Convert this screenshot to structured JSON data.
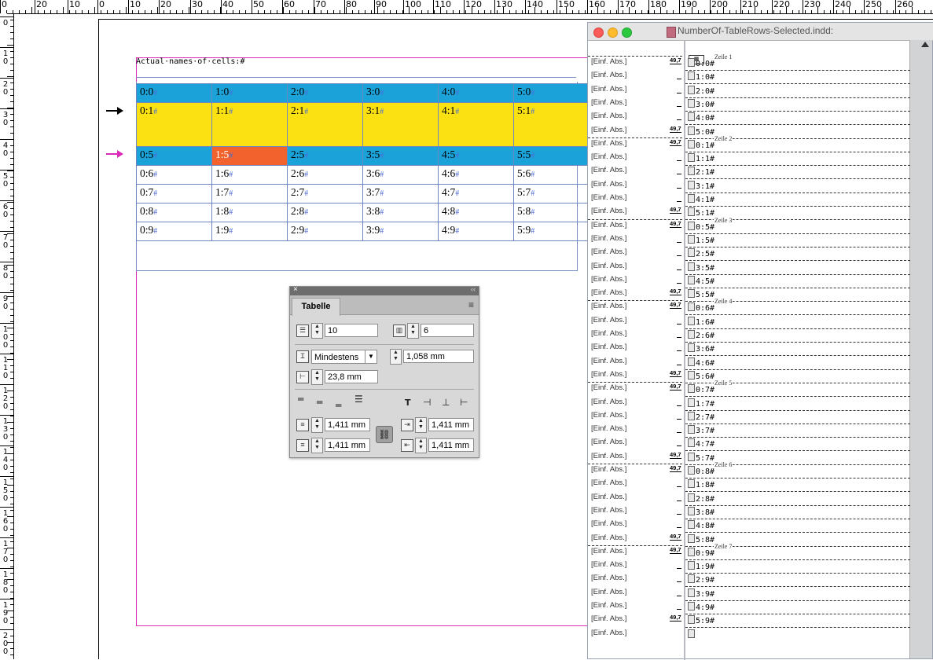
{
  "ruler": {
    "top_labels": [
      "0",
      "20",
      "10",
      "0",
      "10",
      "20",
      "30",
      "40",
      "50",
      "60",
      "70",
      "80",
      "90",
      "100",
      "110",
      "120",
      "130",
      "140",
      "150",
      "160",
      "170",
      "180",
      "190",
      "200",
      "210",
      "220",
      "230",
      "240",
      "250",
      "260"
    ],
    "left_labels": [
      "0",
      "10",
      "20",
      "30",
      "40",
      "50",
      "60",
      "70",
      "80",
      "90",
      "100",
      "110",
      "120",
      "130",
      "140",
      "150",
      "160",
      "170",
      "180",
      "190",
      "200"
    ]
  },
  "frame": {
    "header": "Actual·names·of·cells:#"
  },
  "table": {
    "rows": [
      [
        "0:0",
        "1:0",
        "2:0",
        "3:0",
        "4:0",
        "5:0"
      ],
      [
        "0:1",
        "1:1",
        "2:1",
        "3:1",
        "4:1",
        "5:1"
      ],
      [
        "0:5",
        "1:5",
        "2:5",
        "3:5",
        "4:5",
        "5:5"
      ],
      [
        "0:6",
        "1:6",
        "2:6",
        "3:6",
        "4:6",
        "5:6"
      ],
      [
        "0:7",
        "1:7",
        "2:7",
        "3:7",
        "4:7",
        "5:7"
      ],
      [
        "0:8",
        "1:8",
        "2:8",
        "3:8",
        "4:8",
        "5:8"
      ],
      [
        "0:9",
        "1:9",
        "2:9",
        "3:9",
        "4:9",
        "5:9"
      ]
    ],
    "hash": "#",
    "colors": {
      "blue_row": "#1ba3d9",
      "yellow_row": "#fbe112",
      "selected_cell": "#f2622d",
      "arrow_black": "#000000",
      "arrow_magenta": "#d92bb6"
    }
  },
  "panel": {
    "close": "×",
    "collapse": "‹‹",
    "tab": "Tabelle",
    "menu": "≡",
    "rows_value": "10",
    "cols_value": "6",
    "row_height_mode": "Mindestens",
    "row_height_value": "1,058 mm",
    "col_width_value": "23,8 mm",
    "inset_top": "1,411 mm",
    "inset_bottom": "1,411 mm",
    "inset_left": "1,411 mm",
    "inset_right": "1,411 mm",
    "chain_icon": "⛓"
  },
  "story": {
    "title": "NumberOf-TableRows-Selected.indd:",
    "style_label": "[Einf. Abs.]",
    "depth_value": "49,7",
    "zeile_labels": [
      "Zeile 1",
      "Zeile 2",
      "Zeile 3",
      "Zeile 4",
      "Zeile 5",
      "Zeile 6",
      "Zeile 7"
    ],
    "cells": [
      [
        "0:0#",
        "1:0#",
        "2:0#",
        "3:0#",
        "4:0#",
        "5:0#"
      ],
      [
        "0:1#",
        "1:1#",
        "2:1#",
        "3:1#",
        "4:1#",
        "5:1#"
      ],
      [
        "0:5#",
        "1:5#",
        "2:5#",
        "3:5#",
        "4:5#",
        "5:5#"
      ],
      [
        "0:6#",
        "1:6#",
        "2:6#",
        "3:6#",
        "4:6#",
        "5:6#"
      ],
      [
        "0:7#",
        "1:7#",
        "2:7#",
        "3:7#",
        "4:7#",
        "5:7#"
      ],
      [
        "0:8#",
        "1:8#",
        "2:8#",
        "3:8#",
        "4:8#",
        "5:8#"
      ],
      [
        "0:9#",
        "1:9#",
        "2:9#",
        "3:9#",
        "4:9#",
        "5:9#"
      ]
    ],
    "last_style_label": "[Einf. Abs.]"
  }
}
